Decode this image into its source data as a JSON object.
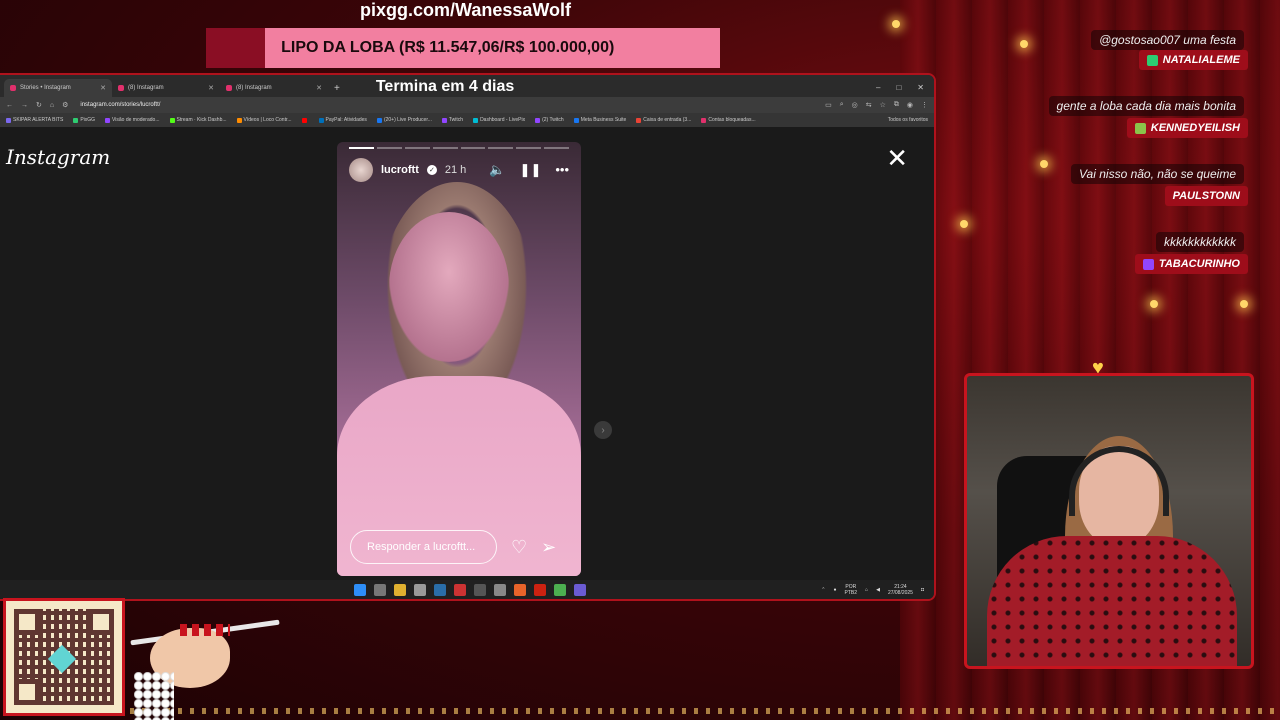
{
  "overlay": {
    "pix_url": "pixgg.com/WanessaWolf",
    "goal_text": "LIPO DA LOBA (R$ 11.547,06/R$ 100.000,00)",
    "goal_progress": 0.115,
    "deadline": "Termina em 4 dias"
  },
  "browser": {
    "tabs": [
      {
        "label": "Stories • Instagram",
        "active": true
      },
      {
        "label": "(8) Instagram",
        "active": false
      },
      {
        "label": "(8) Instagram",
        "active": false
      }
    ],
    "url": "instagram.com/stories/lucroftt/",
    "bookmarks": [
      {
        "label": "SKIPAR ALERTA BITS",
        "color": "#7b68ee"
      },
      {
        "label": "PixGG",
        "color": "#2ecc71"
      },
      {
        "label": "Visão de moderado...",
        "color": "#9146ff"
      },
      {
        "label": "Stream · Kick Dashb...",
        "color": "#53fc18"
      },
      {
        "label": "Vídeos | Loco Contr...",
        "color": "#ff8c00"
      },
      {
        "label": "",
        "color": "#ff0000"
      },
      {
        "label": "PayPal: Atividades",
        "color": "#0070ba"
      },
      {
        "label": "(20+) Live Producer...",
        "color": "#1877f2"
      },
      {
        "label": "Twitch",
        "color": "#9146ff"
      },
      {
        "label": "Dashboard - LivePix",
        "color": "#00bcd4"
      },
      {
        "label": "(2) Twitch",
        "color": "#9146ff"
      },
      {
        "label": "Meta Business Suite",
        "color": "#1877f2"
      },
      {
        "label": "Caixa de entrada (3...",
        "color": "#ea4335"
      },
      {
        "label": "Contas bloqueadas...",
        "color": "#e1306c"
      }
    ],
    "bookmarks_all": "Todos os favoritos"
  },
  "instagram": {
    "logo": "Instagram",
    "username": "lucroftt",
    "time": "21 h",
    "reply_placeholder": "Responder a lucroftt...",
    "progress_segments": 8,
    "progress_done": 1
  },
  "taskbar": {
    "lang": "POR",
    "lang2": "PTB2",
    "time": "21:24",
    "date": "27/08/2025"
  },
  "chat": [
    {
      "message": "@gostosao007 uma festa",
      "user": "NATALIALEME",
      "badge_color": "#2ecc71"
    },
    {
      "message": "gente a loba cada dia mais bonita",
      "user": "KENNEDYEILISH",
      "badge_color": "#8bc34a"
    },
    {
      "message": "Vai nisso não, não se queime",
      "user": "PAULSTONN",
      "badge_color": ""
    },
    {
      "message": "kkkkkkkkkkkk",
      "user": "TABACURINHO",
      "badge_color": "#9146ff"
    }
  ],
  "icons": {
    "close": "close-icon",
    "mute": "speaker-icon",
    "pause": "pause-icon",
    "more": "more-icon",
    "heart": "heart-icon",
    "send": "send-icon"
  }
}
